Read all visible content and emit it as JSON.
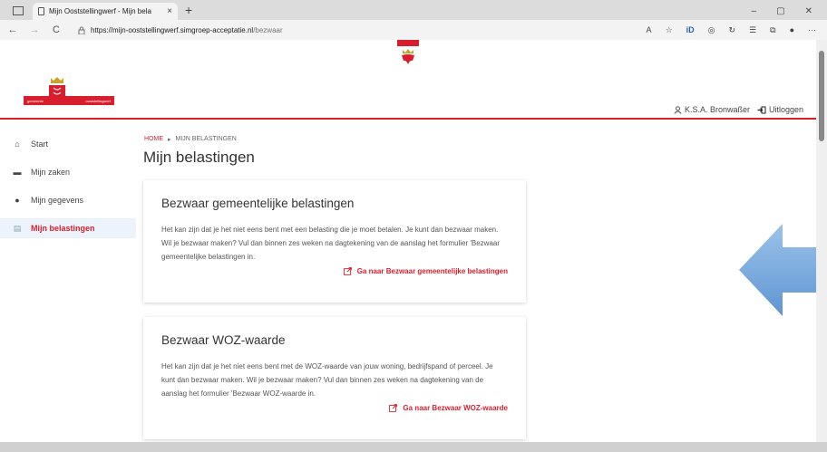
{
  "browser": {
    "tab_title": "Mijn Ooststellingwerf - Mijn bela",
    "tab_close": "×",
    "new_tab": "+",
    "minimize": "–",
    "restore": "▢",
    "close": "✕",
    "url_host": "https://mijn-ooststellingwerf.simgroep-acceptatie.nl",
    "url_path": "/bezwaar",
    "back": "←",
    "forward": "→",
    "reload": "C",
    "more": "···"
  },
  "header": {
    "logo_left_text": "gemeente",
    "logo_right_text": "ooststellingwerf",
    "user_name": "K.S.A. Bronwaßer",
    "logout_label": "Uitloggen"
  },
  "sidebar": {
    "items": [
      {
        "label": "Start",
        "icon": "home-icon"
      },
      {
        "label": "Mijn zaken",
        "icon": "archive-icon"
      },
      {
        "label": "Mijn gegevens",
        "icon": "person-icon"
      },
      {
        "label": "Mijn belastingen",
        "icon": "document-icon",
        "active": true
      }
    ]
  },
  "breadcrumb": {
    "home": "HOME",
    "separator": "▸",
    "current": "MIJN BELASTINGEN"
  },
  "main": {
    "title": "Mijn belastingen",
    "cards": [
      {
        "title": "Bezwaar gemeentelijke belastingen",
        "text": "Het kan zijn dat je het niet eens bent met een belasting die je moet betalen. Je kunt dan bezwaar maken. Wil je bezwaar maken? Vul dan binnen zes weken na dagtekening van de aanslag het formulier 'Bezwaar gemeentelijke belastingen in.",
        "link": "Ga naar Bezwaar gemeentelijke belastingen"
      },
      {
        "title": "Bezwaar WOZ-waarde",
        "text": "Het kan zijn dat je het niet eens bent met de WOZ-waarde van jouw woning, bedrijfspand of perceel. Je kunt dan bezwaar maken. Wil je bezwaar maken? Vul dan binnen zes weken na dagtekening van de aanslag het formulier 'Bezwaar WOZ-waarde in.",
        "link": "Ga naar Bezwaar WOZ-waarde"
      }
    ]
  },
  "colors": {
    "brand_red": "#d81e2c",
    "arrow_blue": "#7fb0e0",
    "active_bg": "#edf3fa"
  }
}
